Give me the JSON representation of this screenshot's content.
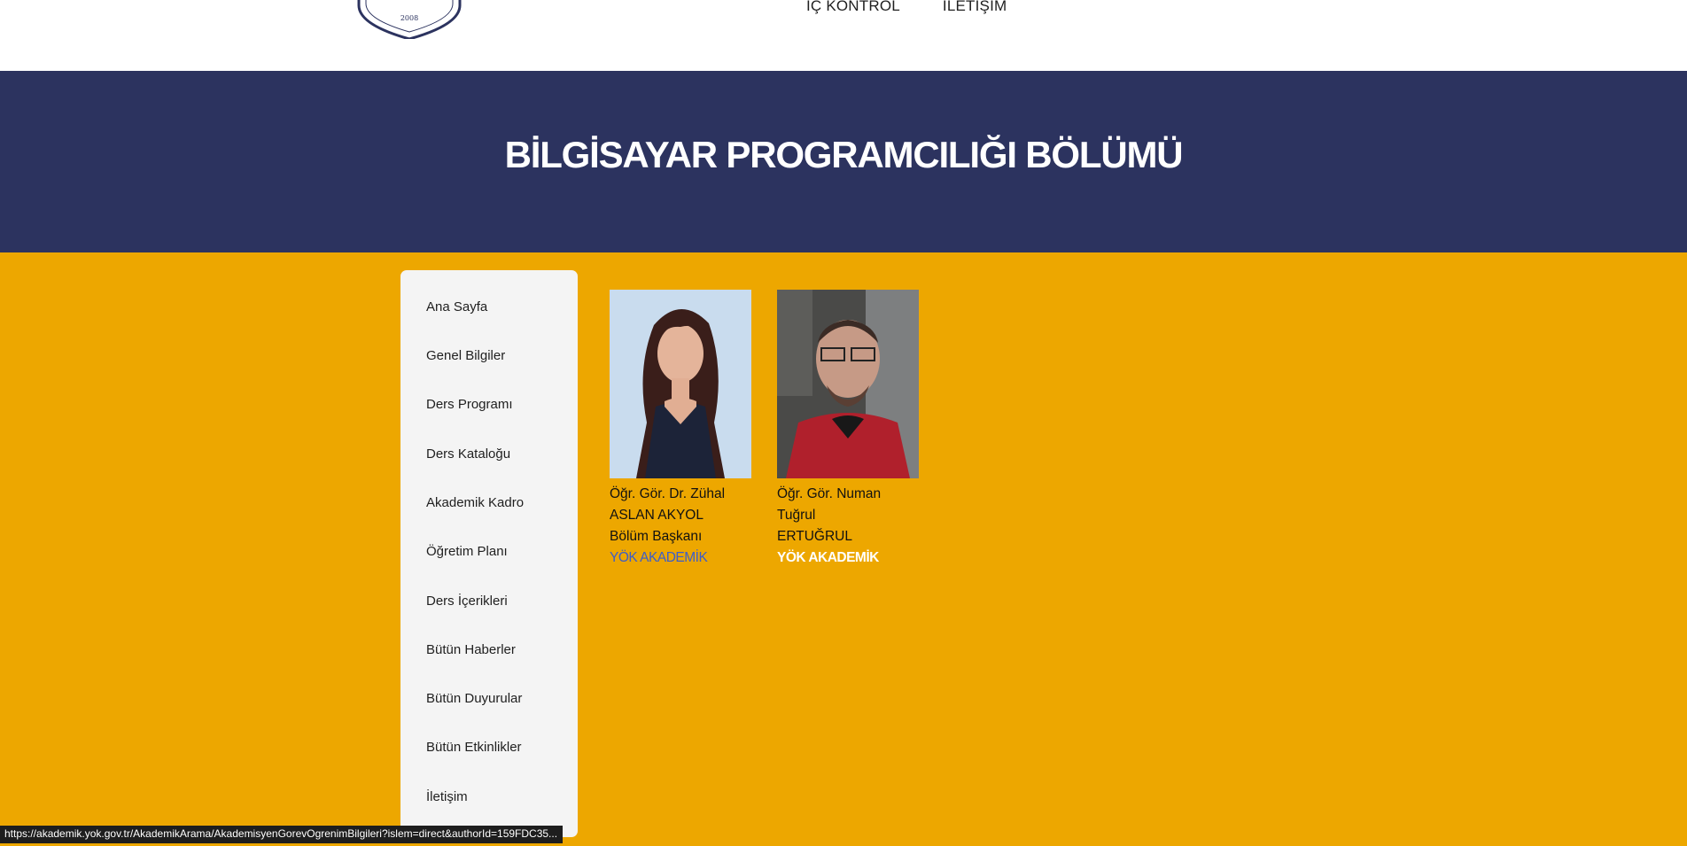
{
  "header": {
    "logo_year": "2008",
    "nav": [
      "İÇ KONTROL",
      "İLETİŞİM"
    ]
  },
  "hero": {
    "title": "BİLGİSAYAR PROGRAMCILIĞI BÖLÜMÜ"
  },
  "sidebar": {
    "items": [
      {
        "label": "Ana Sayfa"
      },
      {
        "label": "Genel Bilgiler"
      },
      {
        "label": "Ders Programı"
      },
      {
        "label": "Ders Kataloğu"
      },
      {
        "label": "Akademik Kadro"
      },
      {
        "label": "Öğretim Planı"
      },
      {
        "label": "Ders İçerikleri"
      },
      {
        "label": "Bütün Haberler"
      },
      {
        "label": "Bütün Duyurular"
      },
      {
        "label": "Bütün Etkinlikler"
      },
      {
        "label": "İletişim"
      }
    ]
  },
  "staff": [
    {
      "name_line1": "Öğr. Gör. Dr. Zühal",
      "name_line2": "ASLAN AKYOL",
      "role": "Bölüm Başkanı",
      "link": "YÖK AKADEMİK"
    },
    {
      "name_line1": "Öğr. Gör. Numan Tuğrul",
      "name_line2": "ERTUĞRUL",
      "role": "",
      "link": "YÖK AKADEMİK"
    }
  ],
  "colors": {
    "hero_bg": "#2c335f",
    "content_bg": "#eda700",
    "sidebar_bg": "#f4f4f4",
    "link_blue": "#3d5ec8"
  },
  "status_url": "https://akademik.yok.gov.tr/AkademikArama/AkademisyenGorevOgrenimBilgileri?islem=direct&authorId=159FDC35..."
}
